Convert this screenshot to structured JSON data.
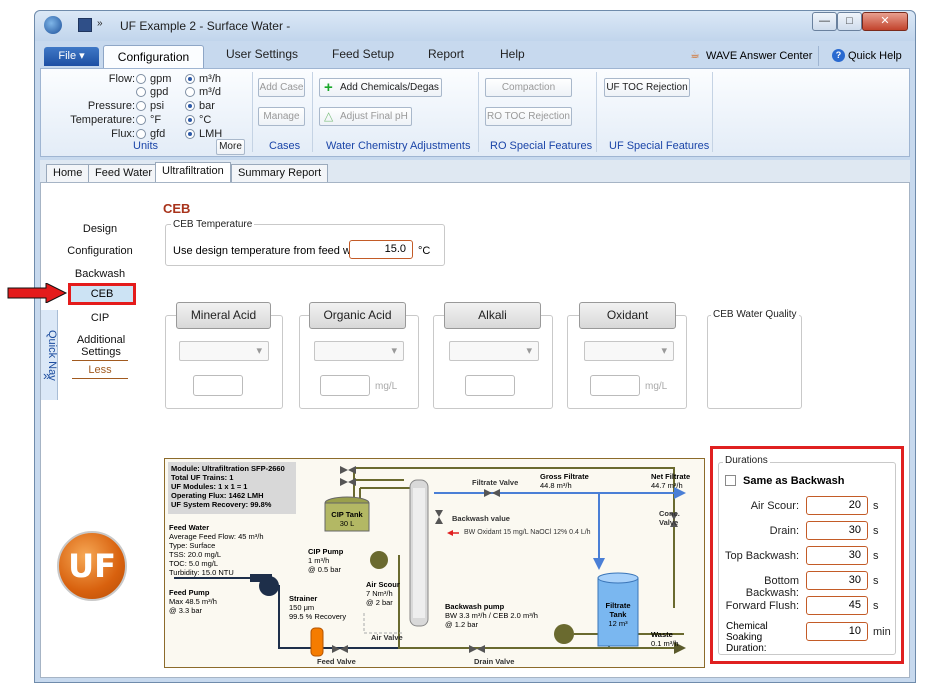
{
  "window": {
    "title": "UF Example 2 - Surface Water -"
  },
  "ribbon_tabs": {
    "file": "File ▾",
    "items": [
      "Configuration",
      "User Settings",
      "Feed Setup",
      "Report",
      "Help"
    ],
    "answer_center": "WAVE Answer Center",
    "quick_help": "Quick Help"
  },
  "units": {
    "flow_label": "Flow:",
    "flow_opt1": "gpm",
    "flow_opt1b": "gpd",
    "flow_opt2": "m³/h",
    "flow_opt2b": "m³/d",
    "pressure_label": "Pressure:",
    "pressure_opt1": "psi",
    "pressure_opt2": "bar",
    "temperature_label": "Temperature:",
    "temperature_opt1": "°F",
    "temperature_opt2": "°C",
    "flux_label": "Flux:",
    "flux_opt1": "gfd",
    "flux_opt2": "LMH",
    "group_label": "Units",
    "more_button": "More"
  },
  "cases": {
    "add_case": "Add Case",
    "manage": "Manage",
    "group_label": "Cases"
  },
  "water_chem": {
    "add_chem": "Add Chemicals/Degas",
    "adjust_ph": "Adjust Final pH",
    "group_label": "Water Chemistry Adjustments"
  },
  "ro_features": {
    "compaction": "Compaction",
    "ro_toc": "RO TOC Rejection",
    "group_label": "RO Special Features"
  },
  "uf_features": {
    "uf_toc": "UF TOC Rejection",
    "group_label": "UF Special Features"
  },
  "page_tabs": [
    "Home",
    "Feed Water",
    "Ultrafiltration",
    "Summary Report"
  ],
  "nav": {
    "items": [
      "Design",
      "Configuration",
      "Backwash",
      "CEB",
      "CIP",
      "Additional Settings",
      "Less"
    ],
    "quick_nav": "Quick Nav",
    "expand": "»"
  },
  "ceb": {
    "heading": "CEB",
    "temp_group": "CEB Temperature",
    "temp_label": "Use design temperature from feed water:",
    "temp_value": "15.0",
    "temp_unit": "°C",
    "chemicals": [
      "Mineral Acid",
      "Organic Acid",
      "Alkali",
      "Oxidant"
    ],
    "unit_mgl": "mg/L",
    "water_quality": "CEB Water Quality"
  },
  "durations": {
    "group": "Durations",
    "same_as_backwash": "Same as Backwash",
    "rows": [
      {
        "label": "Air Scour:",
        "value": "20",
        "unit": "s"
      },
      {
        "label": "Drain:",
        "value": "30",
        "unit": "s"
      },
      {
        "label": "Top Backwash:",
        "value": "30",
        "unit": "s"
      },
      {
        "label": "Bottom Backwash:",
        "value": "30",
        "unit": "s"
      },
      {
        "label": "Forward Flush:",
        "value": "45",
        "unit": "s"
      },
      {
        "label": "Chemical Soaking Duration:",
        "value": "10",
        "unit": "min"
      }
    ]
  },
  "diagram": {
    "module_info": [
      "Module: Ultrafiltration SFP-2660",
      "Total UF Trains: 1",
      "UF Modules: 1 x 1 = 1",
      "Operating Flux: 1462 LMH",
      "UF System Recovery: 99.8%"
    ],
    "feed_water": [
      "Feed Water",
      "Average Feed Flow: 45 m³/h",
      "Type: Surface",
      "TSS: 20.0 mg/L",
      "TOC: 5.0 mg/L",
      "Turbidity: 15.0 NTU"
    ],
    "feed_pump": [
      "Feed Pump",
      "Max 48.5 m³/h",
      "@ 3.3 bar"
    ],
    "cip_tank": [
      "CIP Tank",
      "30 L"
    ],
    "cip_pump": [
      "CIP Pump",
      "1 m³/h",
      "@ 0.5 bar"
    ],
    "air_scour": [
      "Air Scour",
      "7 Nm³/h",
      "@ 2 bar"
    ],
    "strainer": [
      "Strainer",
      "150 μm",
      "99.5 % Recovery"
    ],
    "air_valve": "Air Valve",
    "feed_valve": "Feed Valve",
    "drain_valve": "Drain Valve",
    "filtrate_valve": "Filtrate Valve",
    "gross_filtrate": [
      "Gross Filtrate",
      "44.8 m³/h"
    ],
    "net_filtrate": [
      "Net Filtrate",
      "44.7 m³/h"
    ],
    "backwash_value": "Backwash value",
    "bw_oxidant": "BW Oxidant 15 mg/L NaOCl 12% 0.4 L/h",
    "conc_valve": [
      "Conc.",
      "Valve"
    ],
    "backwash_pump": [
      "Backwash pump",
      "BW 3.3 m³/h / CEB 2.0 m³/h",
      "@ 1.2 bar"
    ],
    "filtrate_tank": [
      "Filtrate",
      "Tank",
      "12 m³"
    ],
    "waste": [
      "Waste",
      "0.1 m³/h"
    ],
    "logo": "UF"
  }
}
